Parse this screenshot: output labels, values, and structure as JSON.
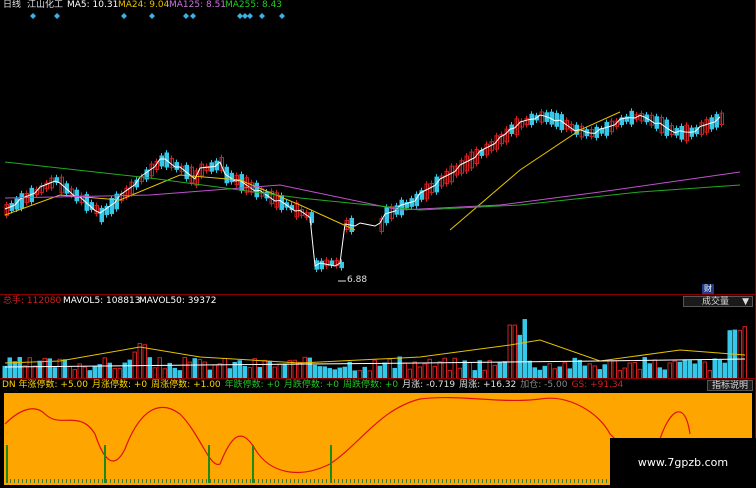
{
  "main": {
    "period": "日线",
    "stock_name": "江山化工",
    "ma5_label": "MA5: 10.31",
    "ma24_label": "MA24: 9.04",
    "ma125_label": "MA125: 8.51",
    "ma255_label": "MA255: 8.43",
    "low_label": "6.88",
    "finance_badge": "财"
  },
  "volume": {
    "total_label": "总手: 112080",
    "mavol5_label": "MAVOL5: 108813",
    "mavol50_label": "MAVOL50: 39372",
    "indicator_select": "成交量"
  },
  "indicator": {
    "items": [
      {
        "text": "DN 年涨停数: +5.00",
        "color": "#ffd400"
      },
      {
        "text": "月涨停数: +0",
        "color": "#ffd400"
      },
      {
        "text": "周涨停数: +1.00",
        "color": "#ffd400"
      },
      {
        "text": "年跌停数: +0",
        "color": "#22c322"
      },
      {
        "text": "月跌停数: +0",
        "color": "#22c322"
      },
      {
        "text": "周跌停数: +0",
        "color": "#22c322"
      },
      {
        "text": "月涨: -0.719",
        "color": "#e0e0e0"
      },
      {
        "text": "周涨: +16.32",
        "color": "#e0e0e0"
      },
      {
        "text": "加仓: -5.00",
        "color": "#888888"
      },
      {
        "text": "GS: +91.34",
        "color": "#d02020"
      }
    ],
    "help_button": "指标说明"
  },
  "watermark": "www.7gpzb.com",
  "colors": {
    "up": "#d02020",
    "down": "#35c8e8",
    "ma5": "#ffffff",
    "ma24": "#e6c200",
    "ma125": "#c050d0",
    "ma255": "#22aa22",
    "indicator_bg": "#ffa500",
    "indicator_line": "#e01010"
  }
}
